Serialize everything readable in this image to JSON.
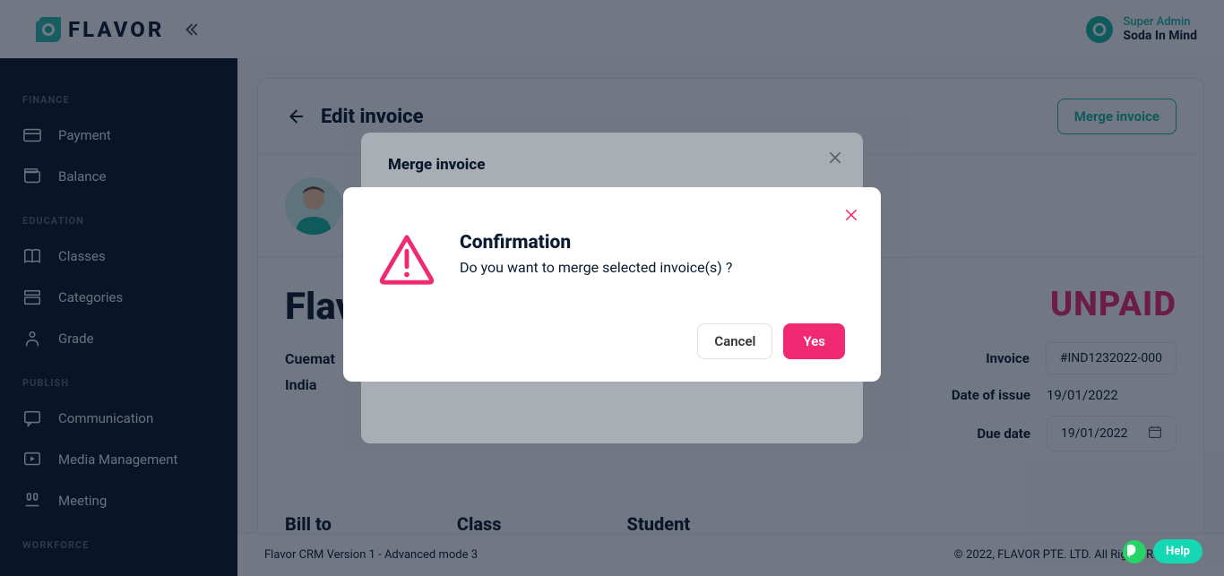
{
  "brand": {
    "name": "FLAVOR",
    "accent": "#14b8a6",
    "pink": "#ef2a72"
  },
  "header": {
    "role": "Super Admin",
    "username": "Soda In Mind"
  },
  "sidebar": {
    "sections": [
      {
        "title": "FINANCE",
        "items": [
          {
            "label": "Payment",
            "icon": "card-icon"
          },
          {
            "label": "Balance",
            "icon": "wallet-icon"
          }
        ]
      },
      {
        "title": "EDUCATION",
        "items": [
          {
            "label": "Classes",
            "icon": "book-icon"
          },
          {
            "label": "Categories",
            "icon": "folder-icon"
          },
          {
            "label": "Grade",
            "icon": "person-icon"
          }
        ]
      },
      {
        "title": "PUBLISH",
        "items": [
          {
            "label": "Communication",
            "icon": "chat-icon"
          },
          {
            "label": "Media Management",
            "icon": "media-icon"
          },
          {
            "label": "Meeting",
            "icon": "meeting-icon"
          }
        ]
      },
      {
        "title": "WORKFORCE",
        "items": []
      }
    ]
  },
  "page": {
    "title": "Edit invoice",
    "merge_button": "Merge invoice",
    "company_title_partial": "Flav",
    "address_line1_partial": "Cuemat",
    "address_line2": "India",
    "status": "UNPAID",
    "meta": {
      "invoice_label": "Invoice",
      "invoice_value": "#IND1232022-000",
      "doi_label": "Date of issue",
      "doi_value": "19/01/2022",
      "due_label": "Due date",
      "due_value": "19/01/2022"
    },
    "cols": {
      "billto": "Bill to",
      "class": "Class",
      "student": "Student"
    }
  },
  "modal_merge": {
    "title": "Merge invoice"
  },
  "modal_confirm": {
    "title": "Confirmation",
    "text": "Do you want to merge selected invoice(s) ?",
    "cancel": "Cancel",
    "yes": "Yes"
  },
  "footer": {
    "version": "Flavor CRM Version 1 - Advanced mode 3",
    "copyright": "© 2022, FLAVOR PTE. LTD. All Rights Reserved."
  },
  "help": {
    "label": "Help"
  }
}
